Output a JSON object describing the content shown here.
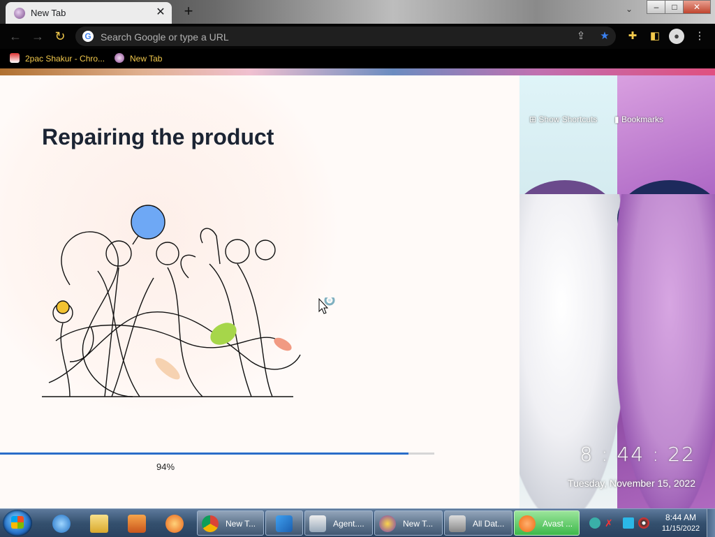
{
  "browser": {
    "tab_title": "New Tab",
    "close_glyph": "✕",
    "newtab_glyph": "+",
    "omnibox_placeholder": "Search Google or type a URL",
    "window_controls": [
      "–",
      "□",
      "✕"
    ],
    "bookmarks": [
      "2pac Shakur - Chro...",
      "New Tab"
    ]
  },
  "newtab_page": {
    "show_shortcuts": "Show Shortcuts",
    "bookmarks": "Bookmarks",
    "clock": "8 : 44 : 22",
    "date": "Tuesday, November 15, 2022"
  },
  "repair_dialog": {
    "title": "Repairing the product",
    "progress_percent": 94,
    "progress_label": "94%",
    "accent_color": "#2a6dc9"
  },
  "taskbar": {
    "pinned": [
      "internet-explorer-icon",
      "file-explorer-icon",
      "media-player-icon",
      "media-center-icon"
    ],
    "tasks": [
      {
        "label": "New T...",
        "icon": "chrome-icon"
      },
      {
        "label": "",
        "icon": "app-icon"
      },
      {
        "label": "Agent....",
        "icon": "window-icon"
      },
      {
        "label": "New T...",
        "icon": "browser-icon"
      },
      {
        "label": "All Dat...",
        "icon": "drive-icon"
      },
      {
        "label": "Avast ...",
        "icon": "avast-icon"
      }
    ],
    "time": "8:44 AM",
    "date": "11/15/2022"
  }
}
